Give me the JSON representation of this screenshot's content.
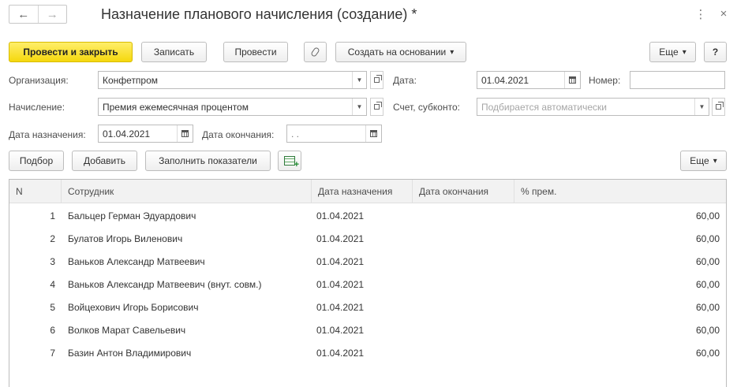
{
  "window": {
    "title": "Назначение планового начисления (создание) *",
    "back_glyph": "←",
    "forward_glyph": "→",
    "menu_glyph": "⋮",
    "close_glyph": "×"
  },
  "toolbar": {
    "post_close": "Провести и закрыть",
    "save": "Записать",
    "post": "Провести",
    "create_based": "Создать на основании",
    "more": "Еще",
    "help": "?",
    "dropdown_glyph": "▾"
  },
  "form": {
    "organization_label": "Организация:",
    "organization_value": "Конфетпром",
    "date_label": "Дата:",
    "date_value": "01.04.2021",
    "number_label": "Номер:",
    "number_value": "",
    "accrual_label": "Начисление:",
    "accrual_value": "Премия ежемесячная процентом",
    "account_label": "Счет, субконто:",
    "account_placeholder": "Подбирается автоматически",
    "assign_date_label": "Дата назначения:",
    "assign_date_value": "01.04.2021",
    "end_date_label": "Дата окончания:",
    "end_date_value": " .  ."
  },
  "table_toolbar": {
    "select": "Подбор",
    "add": "Добавить",
    "fill": "Заполнить показатели",
    "more": "Еще"
  },
  "table": {
    "columns": [
      "N",
      "Сотрудник",
      "Дата назначения",
      "Дата окончания",
      "% прем."
    ],
    "rows": [
      {
        "n": "1",
        "employee": "Бальцер Герман Эдуардович",
        "start": "01.04.2021",
        "end": "",
        "pct": "60,00"
      },
      {
        "n": "2",
        "employee": "Булатов Игорь Виленович",
        "start": "01.04.2021",
        "end": "",
        "pct": "60,00"
      },
      {
        "n": "3",
        "employee": "Ваньков Александр Матвеевич",
        "start": "01.04.2021",
        "end": "",
        "pct": "60,00"
      },
      {
        "n": "4",
        "employee": "Ваньков Александр Матвеевич (внут. совм.)",
        "start": "01.04.2021",
        "end": "",
        "pct": "60,00"
      },
      {
        "n": "5",
        "employee": "Войцехович Игорь Борисович",
        "start": "01.04.2021",
        "end": "",
        "pct": "60,00"
      },
      {
        "n": "6",
        "employee": "Волков Марат Савельевич",
        "start": "01.04.2021",
        "end": "",
        "pct": "60,00"
      },
      {
        "n": "7",
        "employee": "Базин Антон Владимирович",
        "start": "01.04.2021",
        "end": "",
        "pct": "60,00"
      }
    ]
  },
  "colors": {
    "primary_button": "#f5d80d",
    "border": "#bdbdbd",
    "header_bg": "#f2f2f2"
  }
}
